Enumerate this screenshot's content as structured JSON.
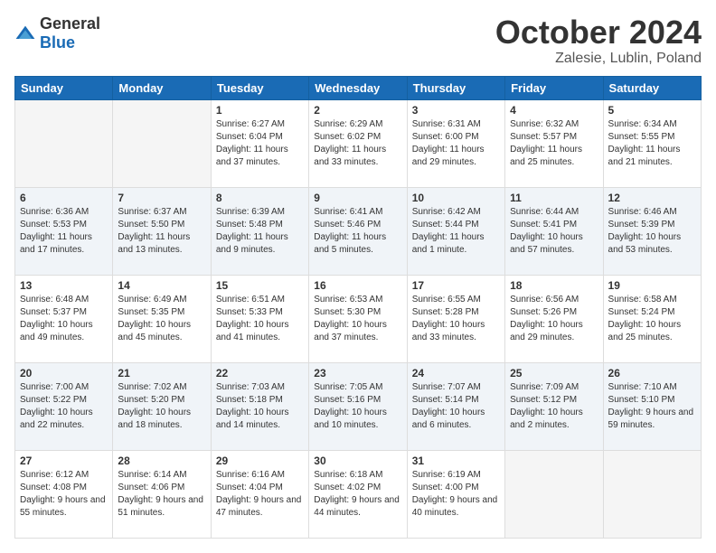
{
  "header": {
    "logo_general": "General",
    "logo_blue": "Blue",
    "month_title": "October 2024",
    "location": "Zalesie, Lublin, Poland"
  },
  "days_of_week": [
    "Sunday",
    "Monday",
    "Tuesday",
    "Wednesday",
    "Thursday",
    "Friday",
    "Saturday"
  ],
  "weeks": [
    [
      {
        "day": "",
        "info": ""
      },
      {
        "day": "",
        "info": ""
      },
      {
        "day": "1",
        "info": "Sunrise: 6:27 AM\nSunset: 6:04 PM\nDaylight: 11 hours and 37 minutes."
      },
      {
        "day": "2",
        "info": "Sunrise: 6:29 AM\nSunset: 6:02 PM\nDaylight: 11 hours and 33 minutes."
      },
      {
        "day": "3",
        "info": "Sunrise: 6:31 AM\nSunset: 6:00 PM\nDaylight: 11 hours and 29 minutes."
      },
      {
        "day": "4",
        "info": "Sunrise: 6:32 AM\nSunset: 5:57 PM\nDaylight: 11 hours and 25 minutes."
      },
      {
        "day": "5",
        "info": "Sunrise: 6:34 AM\nSunset: 5:55 PM\nDaylight: 11 hours and 21 minutes."
      }
    ],
    [
      {
        "day": "6",
        "info": "Sunrise: 6:36 AM\nSunset: 5:53 PM\nDaylight: 11 hours and 17 minutes."
      },
      {
        "day": "7",
        "info": "Sunrise: 6:37 AM\nSunset: 5:50 PM\nDaylight: 11 hours and 13 minutes."
      },
      {
        "day": "8",
        "info": "Sunrise: 6:39 AM\nSunset: 5:48 PM\nDaylight: 11 hours and 9 minutes."
      },
      {
        "day": "9",
        "info": "Sunrise: 6:41 AM\nSunset: 5:46 PM\nDaylight: 11 hours and 5 minutes."
      },
      {
        "day": "10",
        "info": "Sunrise: 6:42 AM\nSunset: 5:44 PM\nDaylight: 11 hours and 1 minute."
      },
      {
        "day": "11",
        "info": "Sunrise: 6:44 AM\nSunset: 5:41 PM\nDaylight: 10 hours and 57 minutes."
      },
      {
        "day": "12",
        "info": "Sunrise: 6:46 AM\nSunset: 5:39 PM\nDaylight: 10 hours and 53 minutes."
      }
    ],
    [
      {
        "day": "13",
        "info": "Sunrise: 6:48 AM\nSunset: 5:37 PM\nDaylight: 10 hours and 49 minutes."
      },
      {
        "day": "14",
        "info": "Sunrise: 6:49 AM\nSunset: 5:35 PM\nDaylight: 10 hours and 45 minutes."
      },
      {
        "day": "15",
        "info": "Sunrise: 6:51 AM\nSunset: 5:33 PM\nDaylight: 10 hours and 41 minutes."
      },
      {
        "day": "16",
        "info": "Sunrise: 6:53 AM\nSunset: 5:30 PM\nDaylight: 10 hours and 37 minutes."
      },
      {
        "day": "17",
        "info": "Sunrise: 6:55 AM\nSunset: 5:28 PM\nDaylight: 10 hours and 33 minutes."
      },
      {
        "day": "18",
        "info": "Sunrise: 6:56 AM\nSunset: 5:26 PM\nDaylight: 10 hours and 29 minutes."
      },
      {
        "day": "19",
        "info": "Sunrise: 6:58 AM\nSunset: 5:24 PM\nDaylight: 10 hours and 25 minutes."
      }
    ],
    [
      {
        "day": "20",
        "info": "Sunrise: 7:00 AM\nSunset: 5:22 PM\nDaylight: 10 hours and 22 minutes."
      },
      {
        "day": "21",
        "info": "Sunrise: 7:02 AM\nSunset: 5:20 PM\nDaylight: 10 hours and 18 minutes."
      },
      {
        "day": "22",
        "info": "Sunrise: 7:03 AM\nSunset: 5:18 PM\nDaylight: 10 hours and 14 minutes."
      },
      {
        "day": "23",
        "info": "Sunrise: 7:05 AM\nSunset: 5:16 PM\nDaylight: 10 hours and 10 minutes."
      },
      {
        "day": "24",
        "info": "Sunrise: 7:07 AM\nSunset: 5:14 PM\nDaylight: 10 hours and 6 minutes."
      },
      {
        "day": "25",
        "info": "Sunrise: 7:09 AM\nSunset: 5:12 PM\nDaylight: 10 hours and 2 minutes."
      },
      {
        "day": "26",
        "info": "Sunrise: 7:10 AM\nSunset: 5:10 PM\nDaylight: 9 hours and 59 minutes."
      }
    ],
    [
      {
        "day": "27",
        "info": "Sunrise: 6:12 AM\nSunset: 4:08 PM\nDaylight: 9 hours and 55 minutes."
      },
      {
        "day": "28",
        "info": "Sunrise: 6:14 AM\nSunset: 4:06 PM\nDaylight: 9 hours and 51 minutes."
      },
      {
        "day": "29",
        "info": "Sunrise: 6:16 AM\nSunset: 4:04 PM\nDaylight: 9 hours and 47 minutes."
      },
      {
        "day": "30",
        "info": "Sunrise: 6:18 AM\nSunset: 4:02 PM\nDaylight: 9 hours and 44 minutes."
      },
      {
        "day": "31",
        "info": "Sunrise: 6:19 AM\nSunset: 4:00 PM\nDaylight: 9 hours and 40 minutes."
      },
      {
        "day": "",
        "info": ""
      },
      {
        "day": "",
        "info": ""
      }
    ]
  ]
}
